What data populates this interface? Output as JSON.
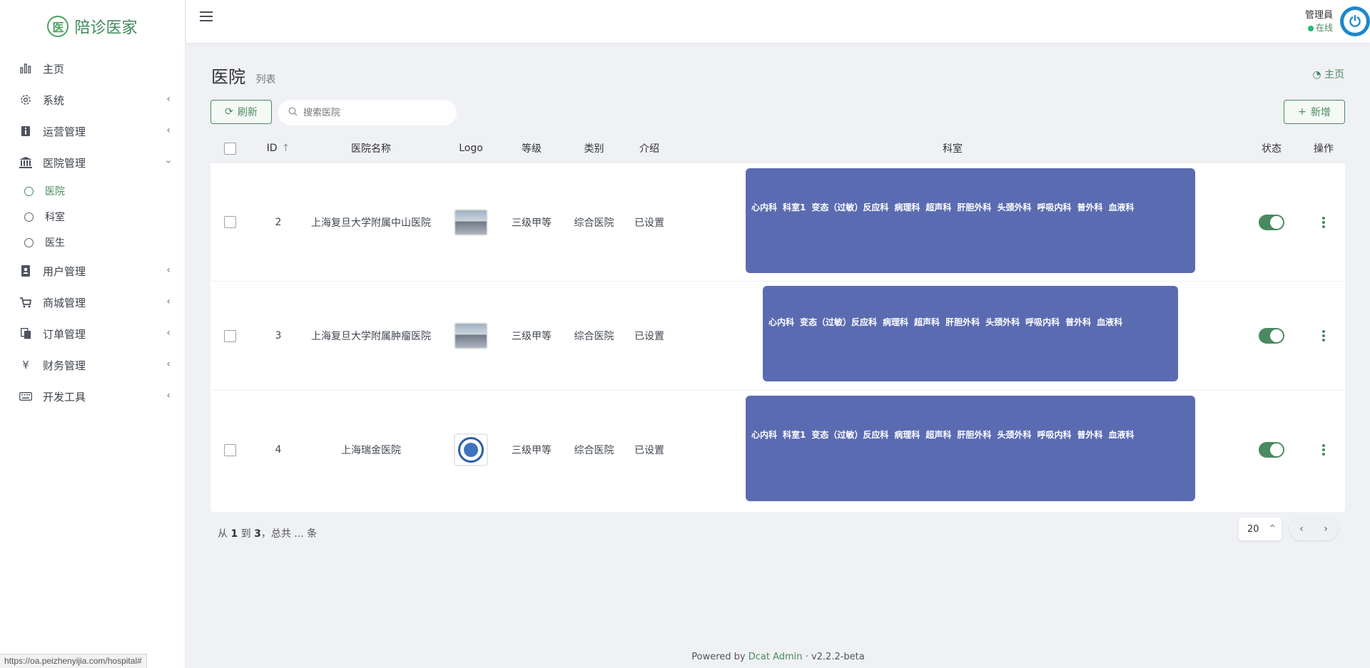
{
  "app": {
    "logo_char": "医",
    "logo_text": "陪诊医家"
  },
  "sidebar": {
    "items": [
      {
        "label": "主页",
        "icon": "bar-chart-icon",
        "has_children": false
      },
      {
        "label": "系统",
        "icon": "gear-icon",
        "has_children": true
      },
      {
        "label": "运营管理",
        "icon": "info-icon",
        "has_children": true
      },
      {
        "label": "医院管理",
        "icon": "bank-icon",
        "has_children": true,
        "expanded": true,
        "children": [
          {
            "label": "医院",
            "active": true
          },
          {
            "label": "科室",
            "active": false
          },
          {
            "label": "医生",
            "active": false
          }
        ]
      },
      {
        "label": "用户管理",
        "icon": "contact-book-icon",
        "has_children": true
      },
      {
        "label": "商城管理",
        "icon": "cart-icon",
        "has_children": true
      },
      {
        "label": "订单管理",
        "icon": "copy-icon",
        "has_children": true
      },
      {
        "label": "财务管理",
        "icon": "yen-icon",
        "has_children": true
      },
      {
        "label": "开发工具",
        "icon": "keyboard-icon",
        "has_children": true
      }
    ]
  },
  "header": {
    "user_name": "管理員",
    "user_status": "在线"
  },
  "page": {
    "title": "医院",
    "subtitle": "列表",
    "breadcrumb": "主页"
  },
  "toolbar": {
    "refresh_label": "刷新",
    "search_placeholder": "搜索医院",
    "add_label": "新增"
  },
  "table": {
    "headers": {
      "id": "ID",
      "name": "医院名称",
      "logo": "Logo",
      "grade": "等级",
      "type": "类别",
      "intro": "介绍",
      "dept": "科室",
      "status": "状态",
      "action": "操作"
    },
    "rows": [
      {
        "id": "2",
        "name": "上海复旦大学附属中山医院",
        "grade": "三级甲等",
        "type": "综合医院",
        "intro": "已设置",
        "depts": [
          "心内科",
          "科室1",
          "变态（过敏）反应科",
          "病理科",
          "超声科",
          "肝胆外科",
          "头颈外科",
          "呼吸内科",
          "普外科",
          "血液科"
        ],
        "status_on": true
      },
      {
        "id": "3",
        "name": "上海复旦大学附属肿瘤医院",
        "grade": "三级甲等",
        "type": "综合医院",
        "intro": "已设置",
        "depts": [
          "心内科",
          "变态（过敏）反应科",
          "病理科",
          "超声科",
          "肝胆外科",
          "头颈外科",
          "呼吸内科",
          "普外科",
          "血液科"
        ],
        "status_on": true
      },
      {
        "id": "4",
        "name": "上海瑞金医院",
        "grade": "三级甲等",
        "type": "综合医院",
        "intro": "已设置",
        "depts": [
          "心内科",
          "科室1",
          "变态（过敏）反应科",
          "病理科",
          "超声科",
          "肝胆外科",
          "头颈外科",
          "呼吸内科",
          "普外科",
          "血液科"
        ],
        "status_on": true
      }
    ]
  },
  "pagination": {
    "info_prefix": "从",
    "from": "1",
    "to_word": "到",
    "to": "3",
    "total_text": "，总共 ... 条",
    "per_page": "20"
  },
  "footer": {
    "powered_by": "Powered by",
    "brand": "Dcat Admin",
    "version": "· v2.2.2-beta"
  },
  "statusbar": {
    "url": "https://oa.peizhenyijia.com/hospital#"
  },
  "colors": {
    "accent": "#4a8a61",
    "dept_box": "#5a6bb1",
    "background": "#eff1f4"
  }
}
